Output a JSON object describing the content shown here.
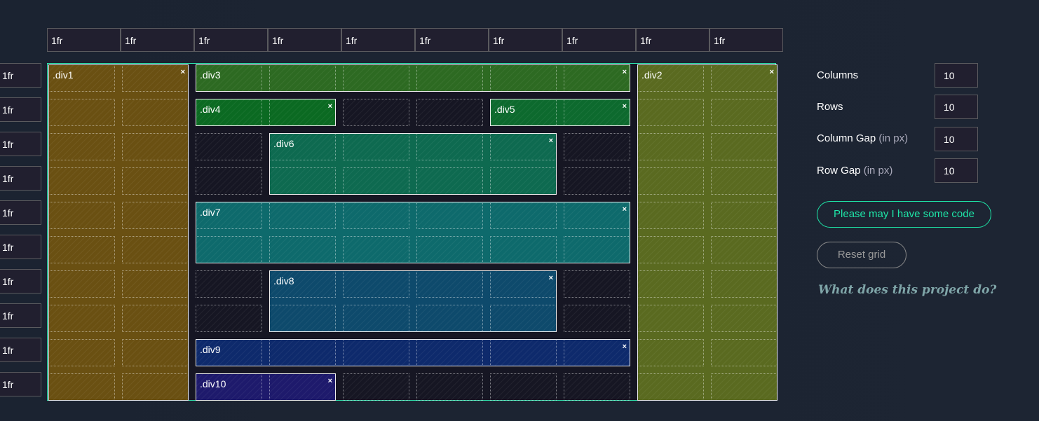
{
  "columns": [
    "1fr",
    "1fr",
    "1fr",
    "1fr",
    "1fr",
    "1fr",
    "1fr",
    "1fr",
    "1fr",
    "1fr"
  ],
  "rows": [
    "1fr",
    "1fr",
    "1fr",
    "1fr",
    "1fr",
    "1fr",
    "1fr",
    "1fr",
    "1fr",
    "1fr"
  ],
  "items": [
    {
      "label": ".div1",
      "area": [
        1,
        1,
        11,
        3
      ],
      "color": "#6a5012"
    },
    {
      "label": ".div2",
      "area": [
        1,
        9,
        11,
        11
      ],
      "color": "#5a6a20"
    },
    {
      "label": ".div3",
      "area": [
        1,
        3,
        2,
        9
      ],
      "color": "#2d6a22"
    },
    {
      "label": ".div4",
      "area": [
        2,
        3,
        3,
        5
      ],
      "color": "#0b6a22"
    },
    {
      "label": ".div5",
      "area": [
        2,
        7,
        3,
        9
      ],
      "color": "#0d6a2e"
    },
    {
      "label": ".div6",
      "area": [
        3,
        4,
        5,
        8
      ],
      "color": "#0e6a50"
    },
    {
      "label": ".div7",
      "area": [
        5,
        3,
        7,
        9
      ],
      "color": "#0e6a6c"
    },
    {
      "label": ".div8",
      "area": [
        7,
        4,
        9,
        8
      ],
      "color": "#0e4a6c"
    },
    {
      "label": ".div9",
      "area": [
        9,
        3,
        10,
        9
      ],
      "color": "#0e2a6c"
    },
    {
      "label": ".div10",
      "area": [
        10,
        3,
        11,
        5
      ],
      "color": "#1e1a6c"
    }
  ],
  "close_glyph": "×",
  "settings": {
    "columns_label": "Columns",
    "columns_value": "10",
    "rows_label": "Rows",
    "rows_value": "10",
    "col_gap_label": "Column Gap",
    "col_gap_unit": "(in px)",
    "col_gap_value": "10",
    "row_gap_label": "Row Gap",
    "row_gap_unit": "(in px)",
    "row_gap_value": "10"
  },
  "code_button": "Please may I have some code",
  "reset_button": "Reset grid",
  "about_link": "What does this project do?",
  "colors": {
    "accent": "#1ee6a8",
    "panel": "#211f2f",
    "background": "#1b2331"
  }
}
